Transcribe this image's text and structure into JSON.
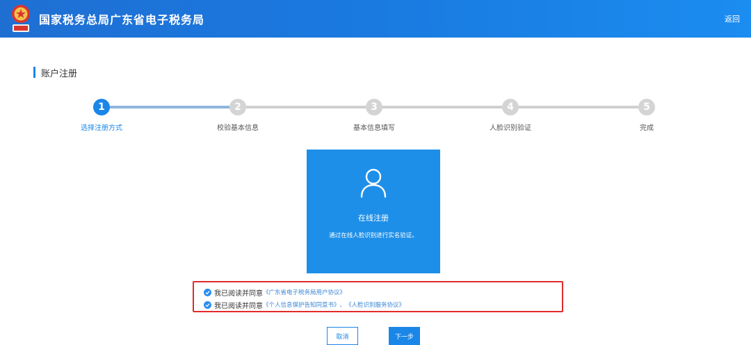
{
  "header": {
    "title": "国家税务总局广东省电子税务局",
    "back_label": "返回"
  },
  "section": {
    "title": "账户注册"
  },
  "steps": [
    {
      "number": "1",
      "label": "选择注册方式",
      "active": true
    },
    {
      "number": "2",
      "label": "校验基本信息",
      "active": false
    },
    {
      "number": "3",
      "label": "基本信息填写",
      "active": false
    },
    {
      "number": "4",
      "label": "人脸识别验证",
      "active": false
    },
    {
      "number": "5",
      "label": "完成",
      "active": false
    }
  ],
  "card": {
    "title": "在线注册",
    "description": "通过在线人脸识别进行实名验证。",
    "icon": "user-icon"
  },
  "agreements": {
    "row1": {
      "prefix": "我已阅读并同意",
      "link": "《广东省电子税务局用户协议》"
    },
    "row2": {
      "prefix": "我已阅读并同意",
      "link1": "《个人信息保护告知同意书》",
      "separator": "、",
      "link2": "《人脸识别服务协议》"
    }
  },
  "buttons": {
    "cancel": "取消",
    "next": "下一步"
  },
  "colors": {
    "primary": "#1a86e8",
    "header_start": "#1f6fd3",
    "header_end": "#1b8cf0",
    "card": "#1e8fe8",
    "highlight_border": "#e02b2b",
    "inactive_step": "#d4d4d4"
  }
}
